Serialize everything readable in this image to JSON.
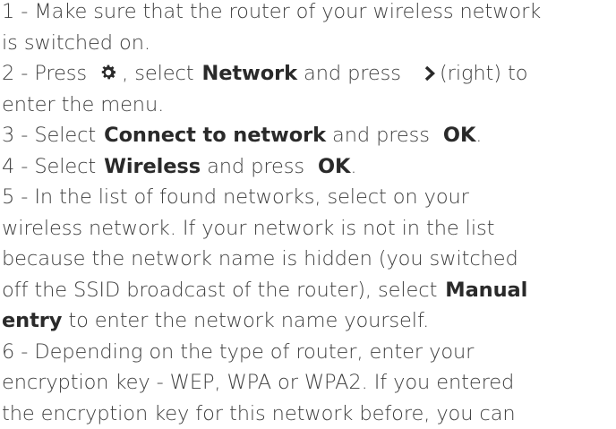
{
  "steps": {
    "s1": {
      "line1": "1 -  Make sure that the router of your wireless network",
      "line2": "is switched on."
    },
    "s2": {
      "pre": "2 -  Press",
      "mid": ", select",
      "key_network": "Network",
      "and_press": "and press",
      "right": "(right) to",
      "line2": "enter the menu."
    },
    "s3": {
      "pre": "3 -  Select",
      "key": "Connect to network",
      "and_press": "and press",
      "ok": "OK",
      "end": "."
    },
    "s4": {
      "pre": "4 -  Select",
      "key": "Wireless",
      "and_press": "and press",
      "ok": "OK",
      "end": "."
    },
    "s5": {
      "line1": "5 -  In the list of found networks, select on your",
      "line2": "wireless network. If your network is not in the list",
      "line3": "because the network name is hidden (you switched",
      "line4_pre": "off the SSID broadcast of the router), select",
      "key_manual": "Manual",
      "key_entry": "entry",
      "line5_post": "to enter the network name yourself."
    },
    "s6": {
      "line1": "6 -  Depending on the type of router, enter your",
      "line2": "encryption key - WEP, WPA or WPA2. If you entered",
      "line3": "the encryption key for this network before, you can"
    }
  },
  "icons": {
    "settings": "gear-icon",
    "right": "chevron-right-icon"
  }
}
